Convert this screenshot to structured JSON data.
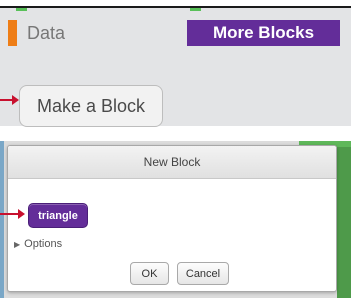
{
  "palette": {
    "data_label": "Data",
    "more_blocks_label": "More Blocks",
    "make_block_label": "Make a Block",
    "colors": {
      "data": "#ee7d16",
      "more_blocks": "#632d99",
      "motion_tick": "#59c059"
    }
  },
  "dialog": {
    "title": "New Block",
    "block_name": "triangle",
    "options_label": "Options",
    "ok_label": "OK",
    "cancel_label": "Cancel",
    "options_icon": "disclosure-triangle-right"
  },
  "annotations": {
    "arrow_color": "#c8102e"
  }
}
